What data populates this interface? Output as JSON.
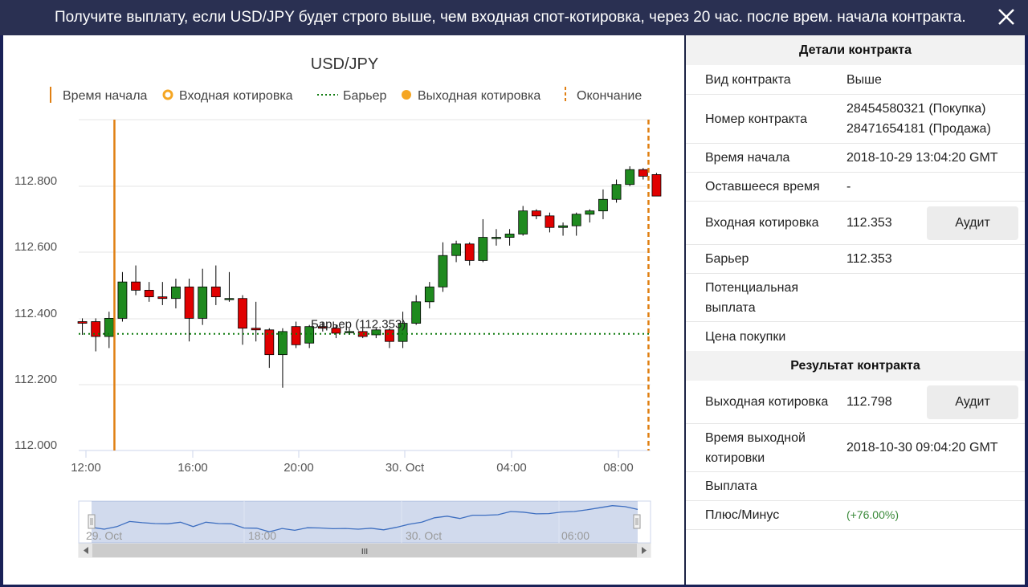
{
  "header": {
    "title": "Получите выплату, если USD/JPY будет строго выше, чем входная спот-котировка, через 20 час. после врем. начала контракта."
  },
  "chart": {
    "title": "USD/JPY",
    "legend": [
      "Время начала",
      "Входная котировка",
      "Барьер",
      "Выходная котировка",
      "Окончание"
    ],
    "y_ticks": [
      "112.800",
      "112.600",
      "112.400",
      "112.200",
      "112.000"
    ],
    "x_ticks": [
      "12:00",
      "16:00",
      "20:00",
      "30. Oct",
      "04:00",
      "08:00"
    ],
    "barrier_label": "Барьер (112.353)",
    "navigator_labels": [
      "29. Oct",
      "18:00",
      "30. Oct",
      "06:00"
    ],
    "scroll_grip": "III"
  },
  "chart_data": {
    "type": "candlestick",
    "title": "USD/JPY",
    "y_range": [
      112.0,
      112.88
    ],
    "x_range": [
      "2018-10-29 11:40",
      "2018-10-30 09:15"
    ],
    "candle_interval_minutes": 30,
    "barrier": 112.353,
    "start_time": "2018-10-29 13:04:20",
    "end_time": "2018-10-30 09:04:20",
    "candles": [
      {
        "t": "11:52",
        "o": 112.39,
        "h": 112.4,
        "l": 112.35,
        "c": 112.385
      },
      {
        "t": "12:22",
        "o": 112.39,
        "h": 112.4,
        "l": 112.3,
        "c": 112.345
      },
      {
        "t": "12:52",
        "o": 112.345,
        "h": 112.42,
        "l": 112.31,
        "c": 112.4
      },
      {
        "t": "13:22",
        "o": 112.4,
        "h": 112.54,
        "l": 112.39,
        "c": 112.51
      },
      {
        "t": "13:52",
        "o": 112.51,
        "h": 112.56,
        "l": 112.47,
        "c": 112.485
      },
      {
        "t": "14:22",
        "o": 112.485,
        "h": 112.51,
        "l": 112.45,
        "c": 112.465
      },
      {
        "t": "14:52",
        "o": 112.465,
        "h": 112.51,
        "l": 112.44,
        "c": 112.46
      },
      {
        "t": "15:22",
        "o": 112.46,
        "h": 112.52,
        "l": 112.43,
        "c": 112.495
      },
      {
        "t": "15:52",
        "o": 112.495,
        "h": 112.52,
        "l": 112.33,
        "c": 112.4
      },
      {
        "t": "16:22",
        "o": 112.4,
        "h": 112.55,
        "l": 112.38,
        "c": 112.495
      },
      {
        "t": "16:52",
        "o": 112.495,
        "h": 112.56,
        "l": 112.44,
        "c": 112.465
      },
      {
        "t": "17:22",
        "o": 112.46,
        "h": 112.54,
        "l": 112.45,
        "c": 112.46
      },
      {
        "t": "17:52",
        "o": 112.46,
        "h": 112.47,
        "l": 112.32,
        "c": 112.37
      },
      {
        "t": "18:22",
        "o": 112.37,
        "h": 112.45,
        "l": 112.33,
        "c": 112.365
      },
      {
        "t": "18:52",
        "o": 112.365,
        "h": 112.37,
        "l": 112.25,
        "c": 112.29
      },
      {
        "t": "19:22",
        "o": 112.29,
        "h": 112.37,
        "l": 112.19,
        "c": 112.36
      },
      {
        "t": "19:52",
        "o": 112.375,
        "h": 112.39,
        "l": 112.31,
        "c": 112.32
      },
      {
        "t": "20:22",
        "o": 112.325,
        "h": 112.38,
        "l": 112.31,
        "c": 112.375
      },
      {
        "t": "20:52",
        "o": 112.375,
        "h": 112.39,
        "l": 112.36,
        "c": 112.37
      },
      {
        "t": "21:22",
        "o": 112.37,
        "h": 112.38,
        "l": 112.34,
        "c": 112.355
      },
      {
        "t": "21:52",
        "o": 112.36,
        "h": 112.37,
        "l": 112.35,
        "c": 112.36
      },
      {
        "t": "22:22",
        "o": 112.36,
        "h": 112.37,
        "l": 112.34,
        "c": 112.345
      },
      {
        "t": "22:52",
        "o": 112.35,
        "h": 112.37,
        "l": 112.34,
        "c": 112.365
      },
      {
        "t": "23:22",
        "o": 112.365,
        "h": 112.37,
        "l": 112.31,
        "c": 112.33
      },
      {
        "t": "23:52",
        "o": 112.33,
        "h": 112.42,
        "l": 112.31,
        "c": 112.385
      },
      {
        "t": "00:22",
        "o": 112.385,
        "h": 112.47,
        "l": 112.38,
        "c": 112.45
      },
      {
        "t": "00:52",
        "o": 112.45,
        "h": 112.51,
        "l": 112.43,
        "c": 112.495
      },
      {
        "t": "01:22",
        "o": 112.495,
        "h": 112.63,
        "l": 112.48,
        "c": 112.59
      },
      {
        "t": "01:52",
        "o": 112.59,
        "h": 112.635,
        "l": 112.57,
        "c": 112.625
      },
      {
        "t": "02:22",
        "o": 112.625,
        "h": 112.63,
        "l": 112.56,
        "c": 112.575
      },
      {
        "t": "02:52",
        "o": 112.575,
        "h": 112.7,
        "l": 112.57,
        "c": 112.645
      },
      {
        "t": "03:22",
        "o": 112.645,
        "h": 112.67,
        "l": 112.62,
        "c": 112.645
      },
      {
        "t": "03:52",
        "o": 112.645,
        "h": 112.67,
        "l": 112.62,
        "c": 112.655
      },
      {
        "t": "04:22",
        "o": 112.655,
        "h": 112.74,
        "l": 112.65,
        "c": 112.725
      },
      {
        "t": "04:52",
        "o": 112.725,
        "h": 112.73,
        "l": 112.7,
        "c": 112.71
      },
      {
        "t": "05:22",
        "o": 112.71,
        "h": 112.72,
        "l": 112.66,
        "c": 112.675
      },
      {
        "t": "05:52",
        "o": 112.675,
        "h": 112.69,
        "l": 112.65,
        "c": 112.68
      },
      {
        "t": "06:22",
        "o": 112.68,
        "h": 112.72,
        "l": 112.65,
        "c": 112.715
      },
      {
        "t": "06:52",
        "o": 112.715,
        "h": 112.73,
        "l": 112.69,
        "c": 112.725
      },
      {
        "t": "07:22",
        "o": 112.725,
        "h": 112.79,
        "l": 112.7,
        "c": 112.76
      },
      {
        "t": "07:52",
        "o": 112.76,
        "h": 112.82,
        "l": 112.75,
        "c": 112.805
      },
      {
        "t": "08:22",
        "o": 112.805,
        "h": 112.86,
        "l": 112.8,
        "c": 112.85
      },
      {
        "t": "08:52",
        "o": 112.85,
        "h": 112.855,
        "l": 112.82,
        "c": 112.83
      },
      {
        "t": "09:22",
        "o": 112.835,
        "h": 112.84,
        "l": 112.77,
        "c": 112.77
      }
    ],
    "colors": {
      "up": "#1f8a1f",
      "down": "#e00000",
      "start_line": "#e07f12",
      "barrier": "#0e7a0e",
      "spot": "#f5a623"
    }
  },
  "details": {
    "title": "Детали контракта",
    "rows": [
      {
        "label": "Вид контракта",
        "value": "Выше"
      },
      {
        "label": "Номер контракта",
        "value": [
          "28454580321 (Покупка)",
          "28471654181 (Продажа)"
        ]
      },
      {
        "label": "Время начала",
        "value": "2018-10-29 13:04:20 GMT"
      },
      {
        "label": "Оставшееся время",
        "value": "-"
      },
      {
        "label": "Входная котировка",
        "value": "112.353",
        "button": "Аудит"
      },
      {
        "label": "Барьер",
        "value": "112.353"
      },
      {
        "label": "Потенциальная выплата",
        "value": ""
      },
      {
        "label": "Цена покупки",
        "value": ""
      }
    ]
  },
  "result": {
    "title": "Результат контракта",
    "rows": [
      {
        "label": "Выходная котировка",
        "value": "112.798",
        "button": "Аудит"
      },
      {
        "label": "Время выходной котировки",
        "value": "2018-10-30 09:04:20 GMT"
      },
      {
        "label": "Выплата",
        "value": ""
      },
      {
        "label": "Плюс/Минус",
        "value": "(+76.00%)"
      }
    ]
  }
}
